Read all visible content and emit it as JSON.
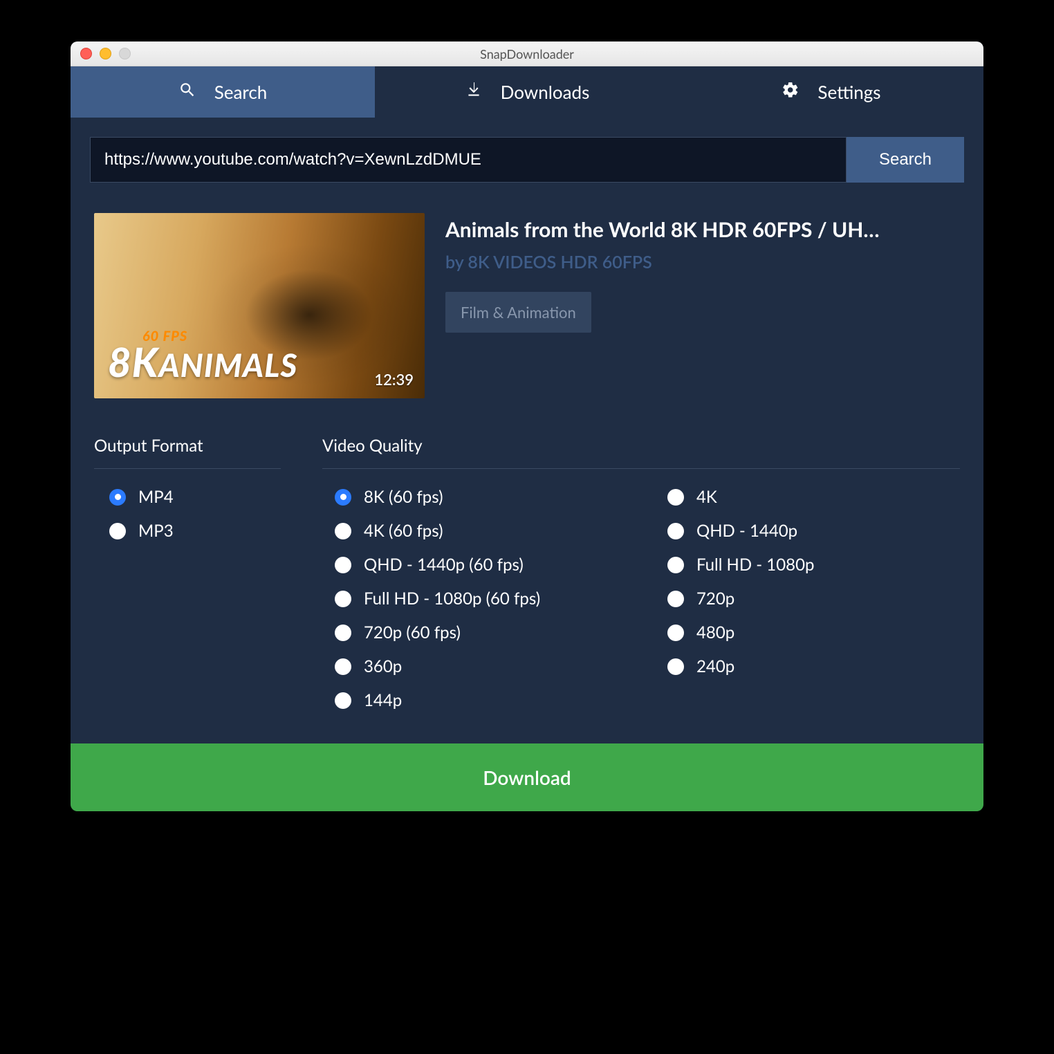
{
  "window": {
    "title": "SnapDownloader"
  },
  "tabs": {
    "search": "Search",
    "downloads": "Downloads",
    "settings": "Settings"
  },
  "searchbar": {
    "url": "https://www.youtube.com/watch?v=XewnLzdDMUE",
    "button": "Search"
  },
  "video": {
    "title": "Animals from the World 8K HDR 60FPS / UH…",
    "channel_prefix": "by ",
    "channel": "8K VIDEOS HDR 60FPS",
    "category": "Film & Animation",
    "duration": "12:39",
    "thumb_fps": "60 FPS",
    "thumb_8k": "8K",
    "thumb_sub": "ANIMALS"
  },
  "sections": {
    "format_title": "Output Format",
    "quality_title": "Video Quality"
  },
  "formats": {
    "mp4": "MP4",
    "mp3": "MP3",
    "selected": "mp4"
  },
  "quality": {
    "selected": "8k60",
    "col1": {
      "q8k60": "8K (60 fps)",
      "q4k60": "4K (60 fps)",
      "qqhd60": "QHD - 1440p (60 fps)",
      "qfhd60": "Full HD - 1080p (60 fps)",
      "q720_60": "720p (60 fps)",
      "q360": "360p",
      "q144": "144p"
    },
    "col2": {
      "q4k": "4K",
      "qqhd": "QHD - 1440p",
      "qfhd": "Full HD - 1080p",
      "q720": "720p",
      "q480": "480p",
      "q240": "240p"
    }
  },
  "download_button": "Download"
}
